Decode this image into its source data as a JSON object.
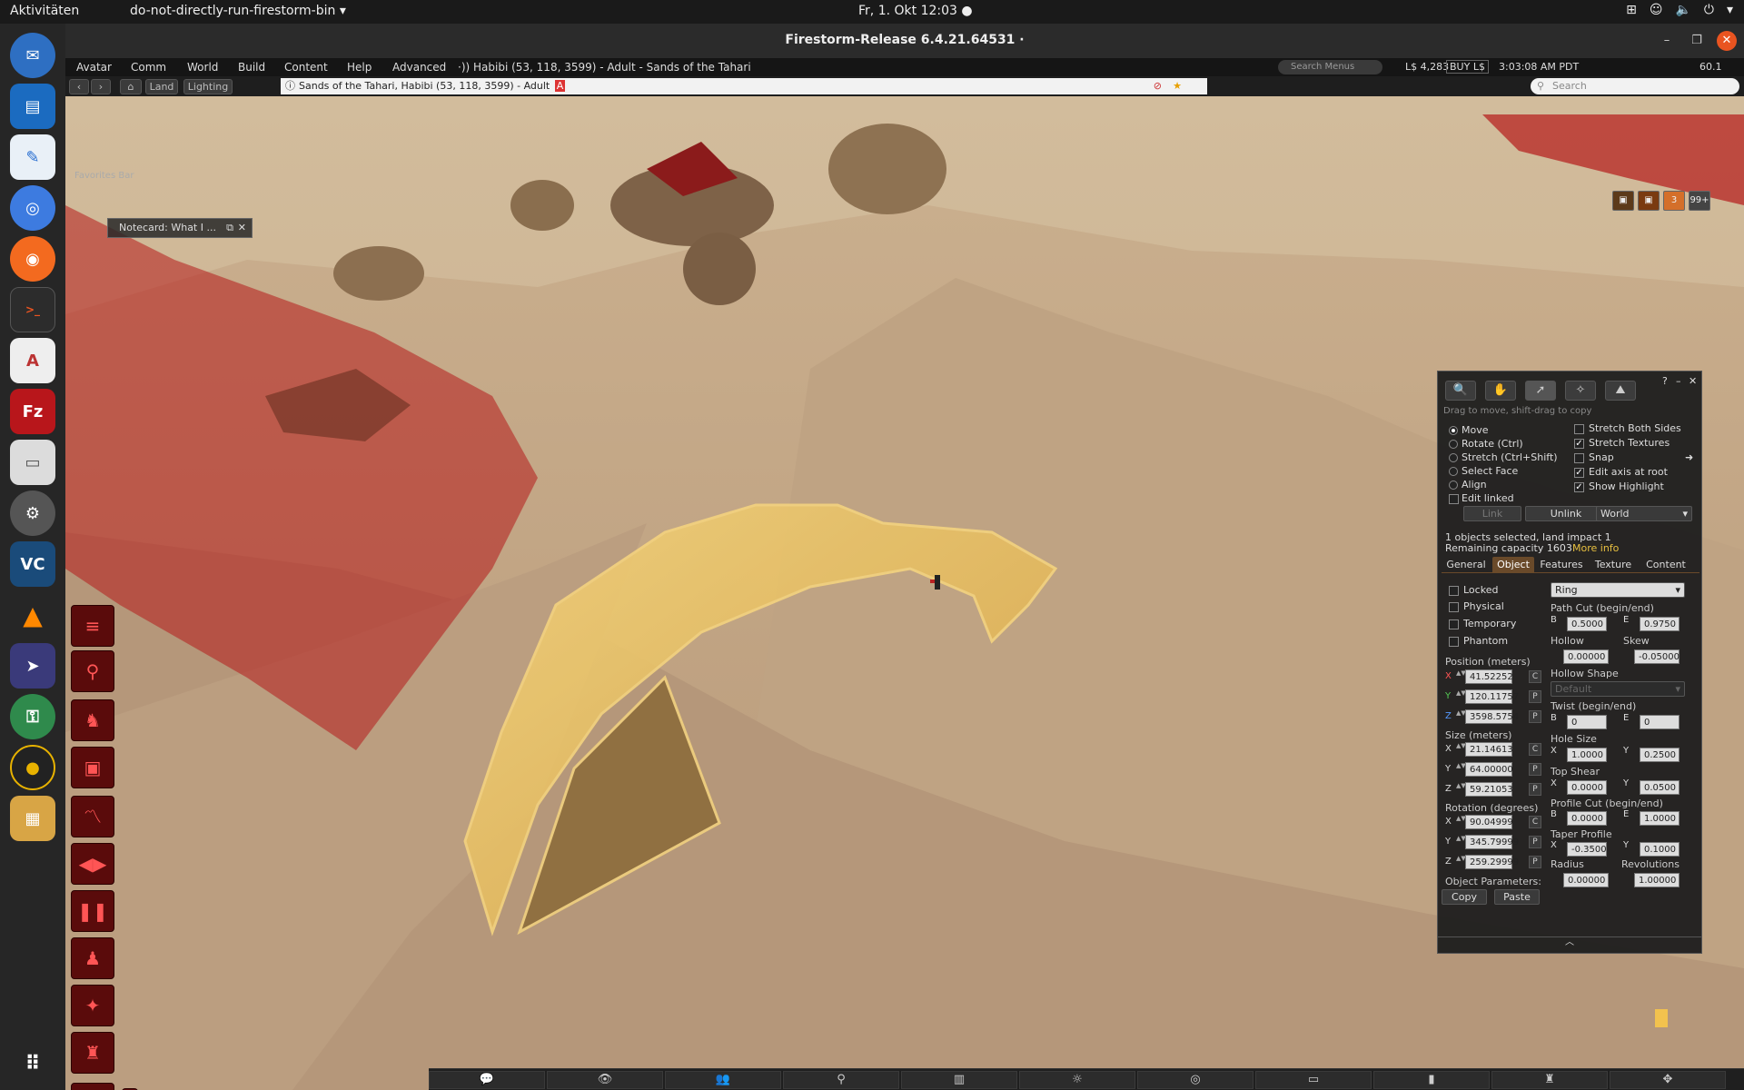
{
  "system": {
    "activities": "Aktivitäten",
    "app_menu": "do-not-directly-run-firestorm-bin",
    "clock": "Fr, 1. Okt  12:03"
  },
  "window": {
    "title": "Firestorm-Release 6.4.21.64531 ·"
  },
  "menubar": {
    "items": [
      "Avatar",
      "Comm",
      "World",
      "Build",
      "Content",
      "Help",
      "Advanced"
    ],
    "location": "Habibi (53, 118, 3599) - Adult - Sands of the Tahari",
    "search_placeholder": "Search Menus",
    "balance": "L$ 4,283",
    "buy_label": "BUY L$",
    "time": "3:03:08 AM PDT",
    "fps": "60.1"
  },
  "navbar": {
    "land_label": "Land",
    "lighting_label": "Lighting",
    "location": "Sands of the Tahari, Habibi (53, 118, 3599) - Adult",
    "rating_badge": "A",
    "search_placeholder": "Search",
    "favorites_label": "Favorites Bar"
  },
  "notecard": {
    "label": "Notecard: What I ..."
  },
  "chiclets": {
    "count1": "3",
    "count2": "99+"
  },
  "build": {
    "hint": "Drag to move, shift-drag to copy",
    "modes": [
      {
        "label": "Move",
        "checked": true
      },
      {
        "label": "Rotate (Ctrl)",
        "checked": false
      },
      {
        "label": "Stretch (Ctrl+Shift)",
        "checked": false
      },
      {
        "label": "Select Face",
        "checked": false
      },
      {
        "label": "Align",
        "checked": false
      }
    ],
    "edit_linked": "Edit linked",
    "options": [
      {
        "label": "Stretch Both Sides",
        "checked": false
      },
      {
        "label": "Stretch Textures",
        "checked": true
      },
      {
        "label": "Snap",
        "checked": false
      },
      {
        "label": "Edit axis at root",
        "checked": true
      },
      {
        "label": "Show Highlight",
        "checked": true
      }
    ],
    "link_label": "Link",
    "unlink_label": "Unlink",
    "ruler": "World",
    "selection_info": "1 objects selected, land impact 1",
    "capacity_info": "Remaining capacity 1603",
    "more_info": "More info",
    "tabs": [
      "General",
      "Object",
      "Features",
      "Texture",
      "Content"
    ],
    "active_tab": "Object",
    "flags": [
      {
        "label": "Locked",
        "checked": false
      },
      {
        "label": "Physical",
        "checked": false
      },
      {
        "label": "Temporary",
        "checked": false
      },
      {
        "label": "Phantom",
        "checked": false
      }
    ],
    "position_label": "Position (meters)",
    "position": {
      "x": "41.52252",
      "y": "120.11757",
      "z": "3598.5754"
    },
    "size_label": "Size (meters)",
    "size": {
      "x": "21.14613",
      "y": "64.00000",
      "z": "59.21053"
    },
    "rotation_label": "Rotation (degrees)",
    "rotation": {
      "x": "90.04999",
      "y": "345.79999",
      "z": "259.29999"
    },
    "object_params_label": "Object Parameters:",
    "copy_label": "Copy",
    "paste_label": "Paste",
    "axis_letters": {
      "x": "X",
      "y": "Y",
      "z": "Z"
    },
    "btn_c": "C",
    "btn_p": "P",
    "prim_type": "Ring",
    "path_cut_label": "Path Cut (begin/end)",
    "path_cut": {
      "b": "0.5000",
      "e": "0.9750"
    },
    "hollow_label": "Hollow",
    "hollow": "0.00000",
    "skew_label": "Skew",
    "skew": "-0.05000",
    "hollow_shape_label": "Hollow Shape",
    "hollow_shape": "Default",
    "twist_label": "Twist (begin/end)",
    "twist": {
      "b": "0",
      "e": "0"
    },
    "hole_size_label": "Hole Size",
    "hole_size": {
      "x": "1.0000",
      "y": "0.2500"
    },
    "top_shear_label": "Top Shear",
    "top_shear": {
      "x": "0.0000",
      "y": "0.0500"
    },
    "profile_cut_label": "Profile Cut (begin/end)",
    "profile_cut": {
      "b": "0.0000",
      "e": "1.0000"
    },
    "taper_profile_label": "Taper Profile",
    "taper_profile": {
      "x": "-0.3500",
      "y": "0.1000"
    },
    "radius_label": "Radius",
    "radius": "0.00000",
    "revolutions_label": "Revolutions",
    "revolutions": "1.00000",
    "letter_b": "B",
    "letter_e": "E",
    "help": "?"
  },
  "colors": {
    "accent_orange": "#e95420",
    "active_tab": "#6a4a2a",
    "toolbar_red": "#5a0b0b",
    "sand": "#c7ab87"
  }
}
